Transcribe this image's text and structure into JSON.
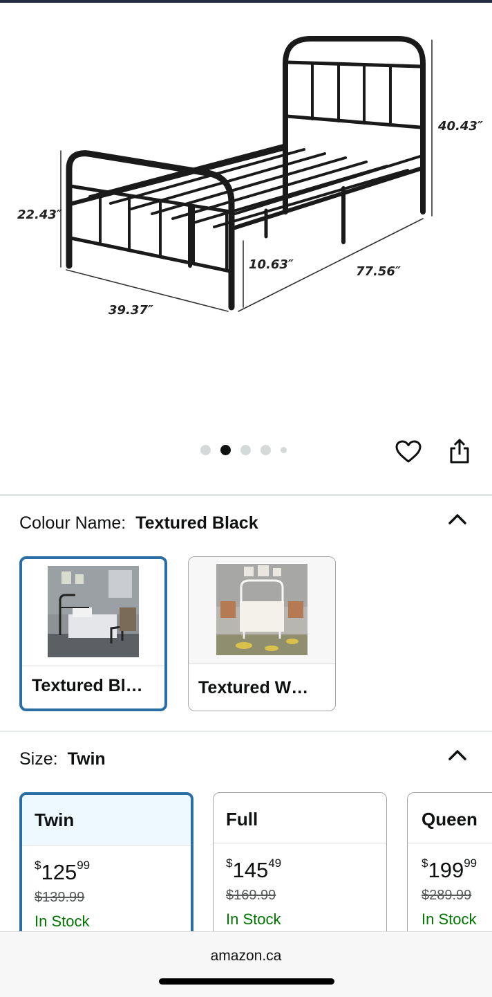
{
  "product_image": {
    "dimensions": {
      "headboard_height": "40.43″",
      "footboard_height": "22.43″",
      "clearance": "10.63″",
      "length": "77.56″",
      "width": "39.37″"
    },
    "carousel": {
      "total": 5,
      "active_index": 1
    }
  },
  "actions": {
    "wishlist_icon": "heart-icon",
    "share_icon": "share-icon"
  },
  "colour": {
    "label": "Colour Name:",
    "selected": "Textured Black",
    "options": [
      {
        "label": "Textured Bl…",
        "selected": true
      },
      {
        "label": "Textured W…",
        "selected": false
      }
    ]
  },
  "size": {
    "label": "Size:",
    "selected": "Twin",
    "options": [
      {
        "name": "Twin",
        "price_currency": "$",
        "price_whole": "125",
        "price_fraction": "99",
        "list_price": "$139.99",
        "availability": "In Stock",
        "selected": true
      },
      {
        "name": "Full",
        "price_currency": "$",
        "price_whole": "145",
        "price_fraction": "49",
        "list_price": "$169.99",
        "availability": "In Stock",
        "selected": false
      },
      {
        "name": "Queen",
        "price_currency": "$",
        "price_whole": "199",
        "price_fraction": "99",
        "list_price": "$289.99",
        "availability": "In Stock",
        "selected": false
      }
    ]
  },
  "browser": {
    "domain": "amazon.ca"
  },
  "colors": {
    "selected_border": "#2b6ea5",
    "in_stock": "#007600",
    "selected_header_bg": "#edf8ff"
  }
}
